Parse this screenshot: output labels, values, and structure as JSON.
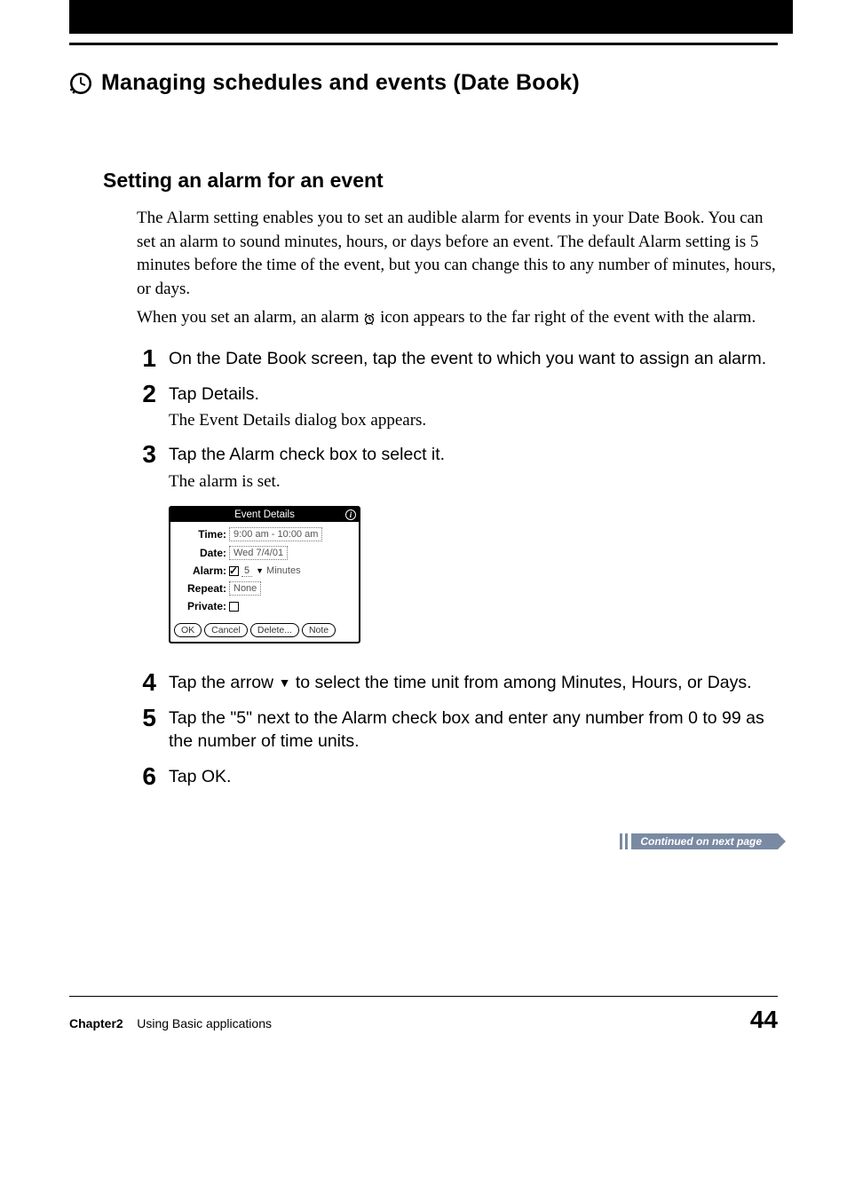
{
  "header": {
    "chapter_title": "Managing schedules and events (Date Book)"
  },
  "section": {
    "title": "Setting an alarm for an event",
    "intro_para1": "The Alarm setting enables you to set an audible alarm for events in your Date Book. You can set an alarm to sound minutes, hours, or days before an event. The default Alarm setting is 5 minutes before the time of the event, but you can change this to any number of minutes, hours, or days.",
    "intro_para2a": "When you set an alarm, an alarm ",
    "intro_para2b": " icon appears to the far right of the event with the alarm."
  },
  "steps": [
    {
      "num": "1",
      "instruction": "On the Date Book screen, tap the event to which you want to assign an alarm.",
      "note": ""
    },
    {
      "num": "2",
      "instruction": "Tap Details.",
      "note": "The Event Details dialog box appears."
    },
    {
      "num": "3",
      "instruction": "Tap the Alarm check box to select it.",
      "note": "The alarm is set."
    },
    {
      "num": "4",
      "instruction_a": "Tap the arrow ",
      "instruction_b": " to select the time unit from among Minutes, Hours, or Days.",
      "note": ""
    },
    {
      "num": "5",
      "instruction": "Tap the \"5\" next to the Alarm check box and enter any number from 0 to 99 as the number of time units.",
      "note": ""
    },
    {
      "num": "6",
      "instruction": "Tap OK.",
      "note": ""
    }
  ],
  "dialog": {
    "title": "Event Details",
    "info": "i",
    "time_label": "Time:",
    "time_value": "9:00 am - 10:00 am",
    "date_label": "Date:",
    "date_value": "Wed 7/4/01",
    "alarm_label": "Alarm:",
    "alarm_value": "5",
    "alarm_unit": "Minutes",
    "repeat_label": "Repeat:",
    "repeat_value": "None",
    "private_label": "Private:",
    "buttons": {
      "ok": "OK",
      "cancel": "Cancel",
      "delete": "Delete...",
      "note": "Note"
    }
  },
  "continued": "Continued on next page",
  "footer": {
    "chapter_label": "Chapter2",
    "chapter_text": "Using Basic applications",
    "page_number": "44"
  }
}
